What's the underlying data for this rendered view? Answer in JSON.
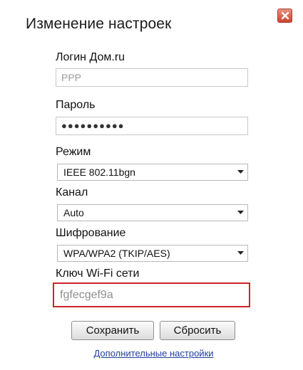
{
  "dialog": {
    "title": "Изменение настроек",
    "close_icon": "close-icon"
  },
  "form": {
    "login": {
      "label": "Логин Дом.ru",
      "value": "PPP"
    },
    "password": {
      "label": "Пароль",
      "value": "●●●●●●●●●●"
    },
    "mode": {
      "label": "Режим",
      "selected": "IEEE 802.11bgn"
    },
    "channel": {
      "label": "Канал",
      "selected": "Auto"
    },
    "encryption": {
      "label": "Шифрование",
      "selected": "WPA/WPA2 (TKIP/AES)"
    },
    "wifi_key": {
      "label": "Ключ Wi-Fi сети",
      "value": "fgfecgef9a",
      "highlight_color": "#d0232a"
    }
  },
  "buttons": {
    "save_label": "Сохранить",
    "reset_label": "Сбросить"
  },
  "advanced_link": "Дополнительные настройки",
  "colors": {
    "close_button": "#c9452f",
    "link": "#1f3f9e"
  }
}
